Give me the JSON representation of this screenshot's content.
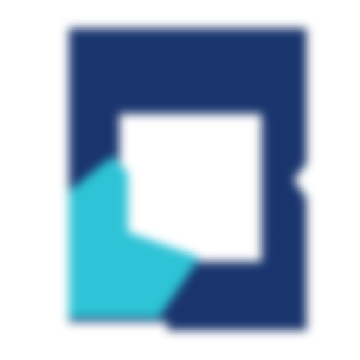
{
  "icon": {
    "name": "app-logo-icon",
    "description_visible": false
  },
  "colors": {
    "background": "#ffffff",
    "navy": "#1a356e",
    "cyan": "#2ec3d6",
    "cutout": "#ffffff"
  }
}
